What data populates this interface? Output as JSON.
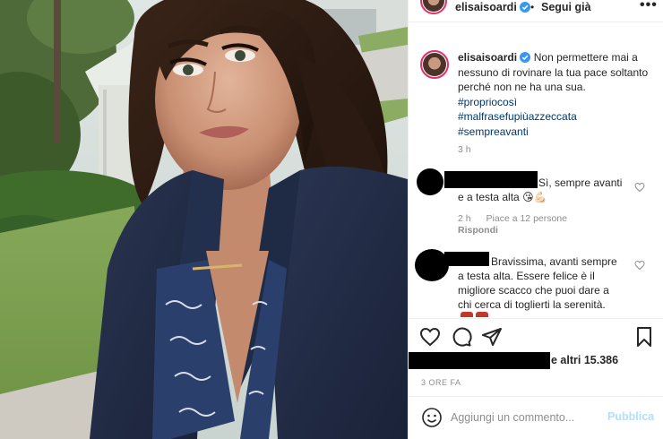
{
  "header": {
    "username": "elisaisoardi",
    "dot": "•",
    "follow_label": "Segui già",
    "more": "•••"
  },
  "caption": {
    "username": "elisaisoardi",
    "text": "Non permettere mai a nessuno di rovinare la tua pace soltanto perché non ne ha una sua.",
    "hashtags": [
      "#propriocosì",
      "#malfrasefupiùazzeccata",
      "#sempreavanti"
    ],
    "time": "3 h"
  },
  "comments": [
    {
      "text_line1": "Sì, sempre avanti",
      "text_line2": "e a testa alta",
      "emoji": "😘💪🏻",
      "time": "2 h",
      "likes": "Piace a 12 persone",
      "reply": "Rispondi"
    },
    {
      "text": "Bravissima, avanti sempre a testa alta. Essere felice è il migliore scacco che puoi dare a chi cerca di toglierti la serenità.",
      "text_lines": [
        "Bravissima, avanti sempre",
        "a testa alta. Essere felice è il",
        "migliore scacco che puoi dare a",
        "chi cerca di toglierti la serenità."
      ]
    }
  ],
  "actions": {
    "like_icon": "heart-icon",
    "comment_icon": "comment-icon",
    "share_icon": "paper-plane-icon",
    "save_icon": "bookmark-icon"
  },
  "likes_text": "e altri 15.386",
  "post_time": "3 ORE FA",
  "add_comment": {
    "placeholder": "Aggiungi un commento...",
    "publish_label": "Pubblica"
  },
  "colors": {
    "link": "#00376b",
    "secondary": "#8e8e8e",
    "publish_disabled": "#b2dffc",
    "verified": "#3897f0"
  }
}
